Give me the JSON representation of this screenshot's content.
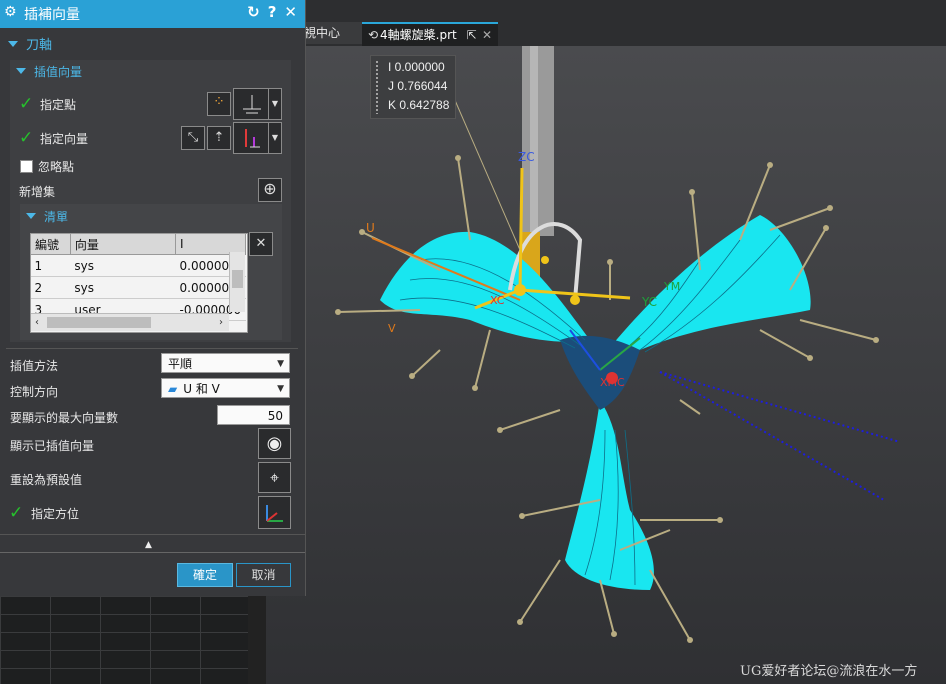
{
  "dialog": {
    "title": "插補向量",
    "section_main": "刀軸",
    "section_interp": "插值向量",
    "specify_point": "指定點",
    "specify_vector": "指定向量",
    "ignore_point": "忽略點",
    "new_set": "新增集",
    "list_header": "清單",
    "table": {
      "columns": [
        "編號",
        "向量",
        "I"
      ],
      "rows": [
        {
          "no": "1",
          "vector": "sys",
          "i": "0.000000"
        },
        {
          "no": "2",
          "vector": "sys",
          "i": "0.000000"
        },
        {
          "no": "3",
          "vector": "user",
          "i": "-0.000000"
        }
      ]
    },
    "interp_method_label": "插值方法",
    "interp_method_value": "平順",
    "control_dir_label": "控制方向",
    "control_dir_value": "U 和 V",
    "max_vectors_label": "要顯示的最大向量數",
    "max_vectors_value": "50",
    "show_vectors_label": "顯示已插值向量",
    "reset_label": "重設為預設值",
    "orientation_label": "指定方位",
    "ok_label": "確定",
    "cancel_label": "取消"
  },
  "tabs": {
    "inactive_label": "視中心",
    "active_label": "4軸螺旋槳.prt"
  },
  "tooltip": {
    "i": "I 0.000000",
    "j": "J 0.766044",
    "k": "K 0.642788"
  },
  "viewport_labels": {
    "zc": "ZC",
    "yc": "YC",
    "xc": "XC",
    "ym": "YM",
    "xmc": "XMC",
    "u": "U",
    "v": "V"
  },
  "watermark": "UG爱好者论坛@流浪在水一方",
  "colors": {
    "accent": "#2aa1d6",
    "mesh": "#19e6f0",
    "arrow": "#b9ad82",
    "check": "#26c12c"
  }
}
